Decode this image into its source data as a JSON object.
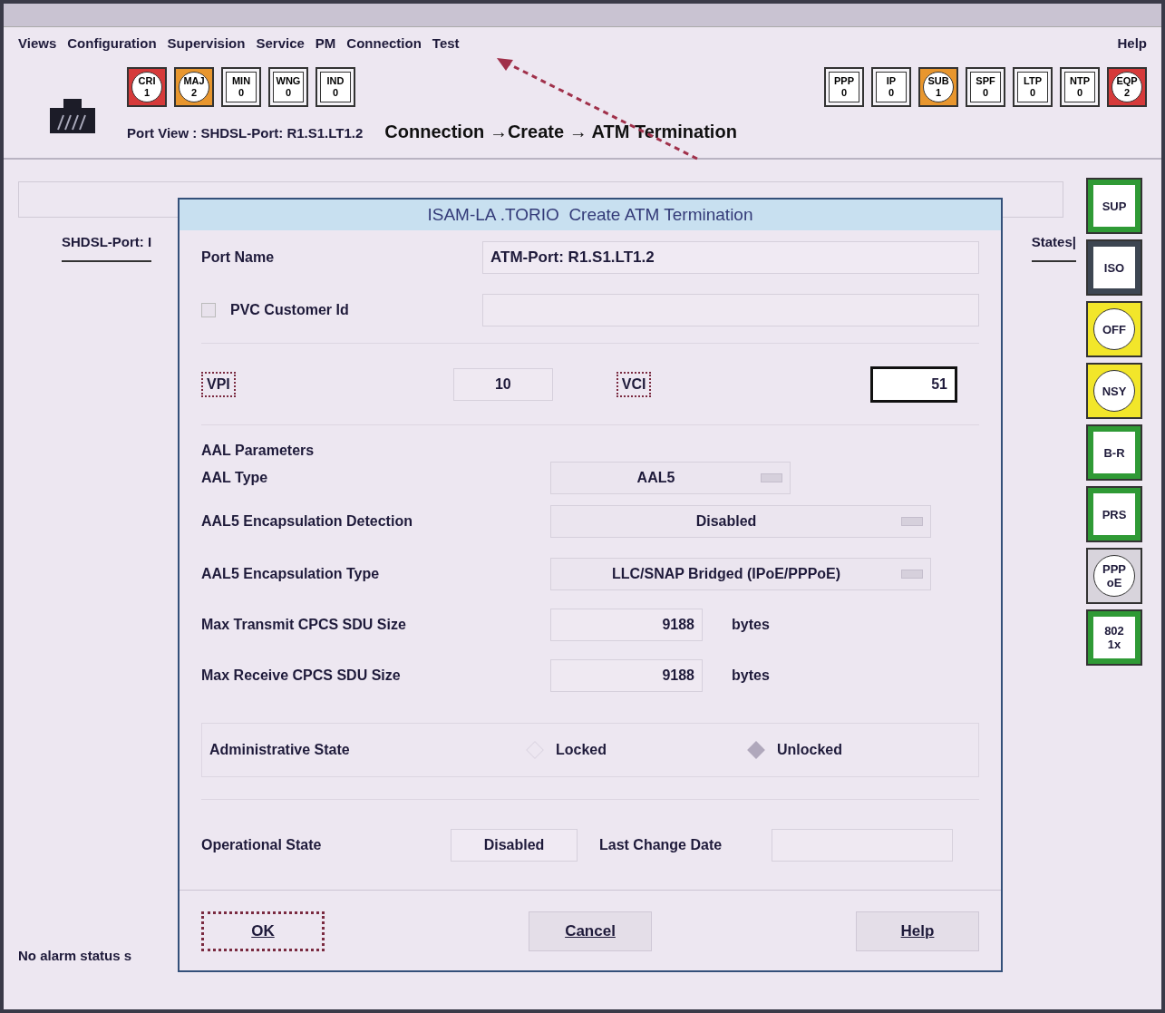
{
  "menu": {
    "left": [
      {
        "label": "Views"
      },
      {
        "label": "Configuration"
      },
      {
        "label": "Supervision"
      },
      {
        "label": "Service"
      },
      {
        "label": "PM"
      },
      {
        "label": "Connection"
      },
      {
        "label": "Test"
      }
    ],
    "right": [
      {
        "label": "Help"
      }
    ]
  },
  "alarms_left": [
    {
      "label": "CRI",
      "count": "1",
      "color": "#d63a3a",
      "kind": "circle"
    },
    {
      "label": "MAJ",
      "count": "2",
      "color": "#e8962e",
      "kind": "circle"
    },
    {
      "label": "MIN",
      "count": "0",
      "color": "#f5f3f7",
      "kind": "square"
    },
    {
      "label": "WNG",
      "count": "0",
      "color": "#f5f3f7",
      "kind": "square"
    },
    {
      "label": "IND",
      "count": "0",
      "color": "#f5f3f7",
      "kind": "square"
    }
  ],
  "alarms_right": [
    {
      "label": "PPP",
      "count": "0",
      "color": "#f5f3f7",
      "kind": "square"
    },
    {
      "label": "IP",
      "count": "0",
      "color": "#f5f3f7",
      "kind": "square"
    },
    {
      "label": "SUB",
      "count": "1",
      "color": "#e8962e",
      "kind": "circle"
    },
    {
      "label": "SPF",
      "count": "0",
      "color": "#f5f3f7",
      "kind": "square"
    },
    {
      "label": "LTP",
      "count": "0",
      "color": "#f5f3f7",
      "kind": "square"
    },
    {
      "label": "NTP",
      "count": "0",
      "color": "#f5f3f7",
      "kind": "square"
    },
    {
      "label": "EQP",
      "count": "2",
      "color": "#d63a3a",
      "kind": "circle"
    }
  ],
  "port_view": "Port View : SHDSL-Port: R1.S1.LT1.2",
  "annotation": "Connection →Create → ATM Termination",
  "background_tabs": [
    "SHDSL-Port: I",
    "States|"
  ],
  "side_buttons": [
    {
      "lines": [
        "SUP"
      ],
      "color": "#2f9a35",
      "kind": "square"
    },
    {
      "lines": [
        "ISO"
      ],
      "color": "#3d4652",
      "kind": "square"
    },
    {
      "lines": [
        "OFF"
      ],
      "color": "#f2e62a",
      "kind": "circle"
    },
    {
      "lines": [
        "NSY"
      ],
      "color": "#f2e62a",
      "kind": "circle"
    },
    {
      "lines": [
        "B-R"
      ],
      "color": "#2f9a35",
      "kind": "square"
    },
    {
      "lines": [
        "PRS"
      ],
      "color": "#2f9a35",
      "kind": "square"
    },
    {
      "lines": [
        "PPP",
        "oE"
      ],
      "color": "#d8d4dc",
      "kind": "circle"
    },
    {
      "lines": [
        "802",
        "1x"
      ],
      "color": "#2f9a35",
      "kind": "square"
    }
  ],
  "status": "No alarm status s",
  "dialog": {
    "title": "ISAM-LA .TORIO  Create ATM Termination",
    "port_name": {
      "label": "Port Name",
      "value": "ATM-Port: R1.S1.LT1.2"
    },
    "pvc": {
      "label": "PVC Customer Id",
      "checked": false
    },
    "vpi": {
      "label": "VPI",
      "value": "10"
    },
    "vci": {
      "label": "VCI",
      "value": "51"
    },
    "aal_heading": "AAL Parameters",
    "aal_type": {
      "label": "AAL Type",
      "value": "AAL5"
    },
    "encap_detection": {
      "label": "AAL5 Encapsulation Detection",
      "value": "Disabled"
    },
    "encap_type": {
      "label": "AAL5 Encapsulation Type",
      "value": "LLC/SNAP Bridged (IPoE/PPPoE)"
    },
    "sizes": [
      {
        "label": "Max Transmit CPCS SDU Size",
        "value": "9188",
        "unit": "bytes"
      },
      {
        "label": "Max Receive CPCS SDU Size",
        "value": "9188",
        "unit": "bytes"
      }
    ],
    "admin": {
      "label": "Administrative State",
      "options": [
        {
          "label": "Locked",
          "selected": false
        },
        {
          "label": "Unlocked",
          "selected": true
        }
      ]
    },
    "oper": {
      "label": "Operational State",
      "value": "Disabled",
      "date_label": "Last Change Date"
    },
    "buttons": [
      {
        "label": "OK",
        "focused": true
      },
      {
        "label": "Cancel",
        "focused": false
      },
      {
        "label": "Help",
        "focused": false
      }
    ]
  }
}
